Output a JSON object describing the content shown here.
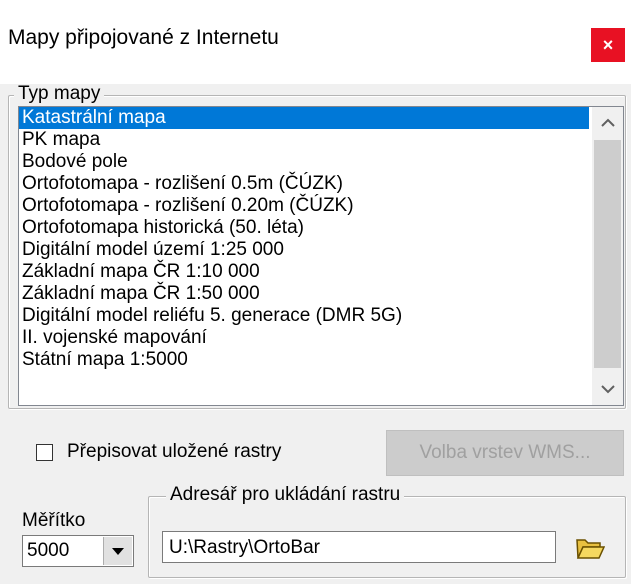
{
  "window": {
    "title": "Mapy připojované z  Internetu",
    "close_label": "×"
  },
  "map_type_group": {
    "legend": "Typ mapy",
    "items": [
      {
        "label": "Katastrální mapa",
        "selected": true
      },
      {
        "label": "PK mapa"
      },
      {
        "label": "Bodové pole"
      },
      {
        "label": "Ortofotomapa - rozlišení 0.5m (ČÚZK)"
      },
      {
        "label": "Ortofotomapa - rozlišení 0.20m (ČÚZK)"
      },
      {
        "label": "Ortofotomapa historická (50. léta)"
      },
      {
        "label": "Digitální model území 1:25 000"
      },
      {
        "label": "Základní mapa ČR 1:10 000"
      },
      {
        "label": "Základní mapa ČR 1:50 000"
      },
      {
        "label": "Digitální model reliéfu 5. generace (DMR 5G)"
      },
      {
        "label": "II. vojenské mapování"
      },
      {
        "label": "Státní mapa 1:5000"
      }
    ]
  },
  "overwrite_checkbox": {
    "label": "Přepisovat uložené rastry",
    "checked": false
  },
  "wms_button": {
    "label": "Volba vrstev WMS..."
  },
  "scale": {
    "label": "Měřítko",
    "value": "5000"
  },
  "directory_group": {
    "legend": "Adresář pro ukládání rastru",
    "value": "U:\\Rastry\\OrtoBar"
  },
  "colors": {
    "selection": "#0078d7",
    "close": "#e81123"
  }
}
